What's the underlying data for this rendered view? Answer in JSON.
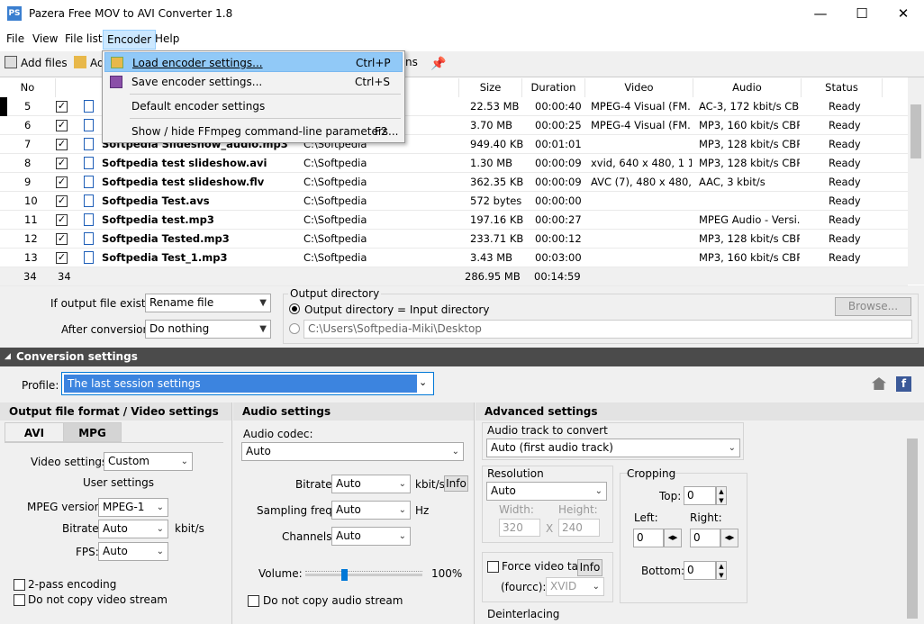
{
  "window": {
    "title": "Pazera Free MOV to AVI Converter 1.8",
    "icon": "PS",
    "min": "—",
    "max": "☐",
    "close": "✕"
  },
  "menu": [
    "File",
    "View",
    "File list",
    "Encoder",
    "Help"
  ],
  "toolbar": {
    "add_files": "Add files",
    "add_folder": "Ad",
    "options": "ns"
  },
  "columns": [
    "No",
    "Size",
    "Duration",
    "Video",
    "Audio",
    "Status"
  ],
  "rows": [
    {
      "no": "5",
      "name": "",
      "dir": "",
      "size": "22.53 MB",
      "dur": "00:00:40",
      "video": "MPEG-4 Visual (FM...",
      "audio": "AC-3, 172 kbit/s  CBR",
      "status": "Ready"
    },
    {
      "no": "6",
      "name": "",
      "dir": "",
      "size": "3.70 MB",
      "dur": "00:00:25",
      "video": "MPEG-4 Visual (FM...",
      "audio": "MP3, 160 kbit/s  CBR",
      "status": "Ready"
    },
    {
      "no": "7",
      "name": "Softpedia Slideshow_audio.mp3",
      "dir": "C:\\Softpedia",
      "size": "949.40 KB",
      "dur": "00:01:01",
      "video": "",
      "audio": "MP3, 128 kbit/s  CBR",
      "status": "Ready"
    },
    {
      "no": "8",
      "name": "Softpedia test slideshow.avi",
      "dir": "C:\\Softpedia",
      "size": "1.30 MB",
      "dur": "00:00:09",
      "video": "xvid, 640 x 480, 1 11...",
      "audio": "MP3, 128 kbit/s  CBR",
      "status": "Ready"
    },
    {
      "no": "9",
      "name": "Softpedia test slideshow.flv",
      "dir": "C:\\Softpedia",
      "size": "362.35 KB",
      "dur": "00:00:09",
      "video": "AVC (7), 480 x 480, 3...",
      "audio": "AAC, 3 kbit/s",
      "status": "Ready"
    },
    {
      "no": "10",
      "name": "Softpedia Test.avs",
      "dir": "C:\\Softpedia",
      "size": "572 bytes",
      "dur": "00:00:00",
      "video": "",
      "audio": "",
      "status": "Ready"
    },
    {
      "no": "11",
      "name": "Softpedia test.mp3",
      "dir": "C:\\Softpedia",
      "size": "197.16 KB",
      "dur": "00:00:27",
      "video": "",
      "audio": "MPEG Audio - Versi...",
      "status": "Ready"
    },
    {
      "no": "12",
      "name": "Softpedia Tested.mp3",
      "dir": "C:\\Softpedia",
      "size": "233.71 KB",
      "dur": "00:00:12",
      "video": "",
      "audio": "MP3, 128 kbit/s  CBR",
      "status": "Ready"
    },
    {
      "no": "13",
      "name": "Softpedia Test_1.mp3",
      "dir": "C:\\Softpedia",
      "size": "3.43 MB",
      "dur": "00:03:00",
      "video": "",
      "audio": "MP3, 160 kbit/s  CBR",
      "status": "Ready"
    }
  ],
  "summary": {
    "count1": "34",
    "count2": "34",
    "size": "286.95 MB",
    "dur": "00:14:59"
  },
  "output": {
    "exists_label": "If output file exists:",
    "exists_value": "Rename file",
    "after_label": "After conversion:",
    "after_value": "Do nothing",
    "dir_group": "Output directory",
    "opt1": "Output directory = Input directory",
    "opt2_path": "C:\\Users\\Softpedia-Miki\\Desktop",
    "browse": "Browse..."
  },
  "conv": {
    "title": "Conversion settings",
    "profile_label": "Profile:",
    "profile_value": "The last session settings"
  },
  "video": {
    "header": "Output file format / Video settings",
    "tab_avi": "AVI",
    "tab_mpg": "MPG",
    "settings_label": "Video settings:",
    "settings_value": "Custom",
    "user_settings": "User settings",
    "mpeg_label": "MPEG version:",
    "mpeg_value": "MPEG-1",
    "bitrate_label": "Bitrate:",
    "bitrate_value": "Auto",
    "bitrate_unit": "kbit/s",
    "fps_label": "FPS:",
    "fps_value": "Auto",
    "twopass": "2-pass encoding",
    "nocopy": "Do not copy video stream"
  },
  "audio": {
    "header": "Audio settings",
    "codec_label": "Audio codec:",
    "codec_value": "Auto",
    "bitrate_label": "Bitrate:",
    "bitrate_value": "Auto",
    "bitrate_unit": "kbit/s",
    "info": "Info",
    "sampling_label": "Sampling freq.:",
    "sampling_value": "Auto",
    "sampling_unit": "Hz",
    "channels_label": "Channels:",
    "channels_value": "Auto",
    "volume_label": "Volume:",
    "volume_value": "100%",
    "volume_level": 0.33,
    "nocopy": "Do not copy audio stream"
  },
  "adv": {
    "header": "Advanced settings",
    "track_label": "Audio track to convert",
    "track_value": "Auto (first audio track)",
    "res_label": "Resolution",
    "res_value": "Auto",
    "width_label": "Width:",
    "width_value": "320",
    "height_label": "Height:",
    "height_value": "240",
    "x": "X",
    "crop_label": "Cropping",
    "top_label": "Top:",
    "top_value": "0",
    "left_label": "Left:",
    "left_value": "0",
    "right_label": "Right:",
    "right_value": "0",
    "bottom_label": "Bottom:",
    "bottom_value": "0",
    "force_label": "Force video tag",
    "info": "Info",
    "fourcc_label": "(fourcc):",
    "fourcc_value": "XVID",
    "deint_label": "Deinterlacing"
  },
  "encoder_menu": [
    {
      "label": "Load encoder settings...",
      "shortcut": "Ctrl+P"
    },
    {
      "label": "Save encoder settings...",
      "shortcut": "Ctrl+S"
    },
    {
      "label": "Default encoder settings",
      "shortcut": ""
    },
    {
      "label": "Show / hide FFmpeg command-line parameters...",
      "shortcut": "F2"
    }
  ],
  "colors": {
    "accent": "#0078d7",
    "selection": "#3c84df",
    "menu_hover": "#cce8ff",
    "section_header": "#4b4b4b"
  }
}
